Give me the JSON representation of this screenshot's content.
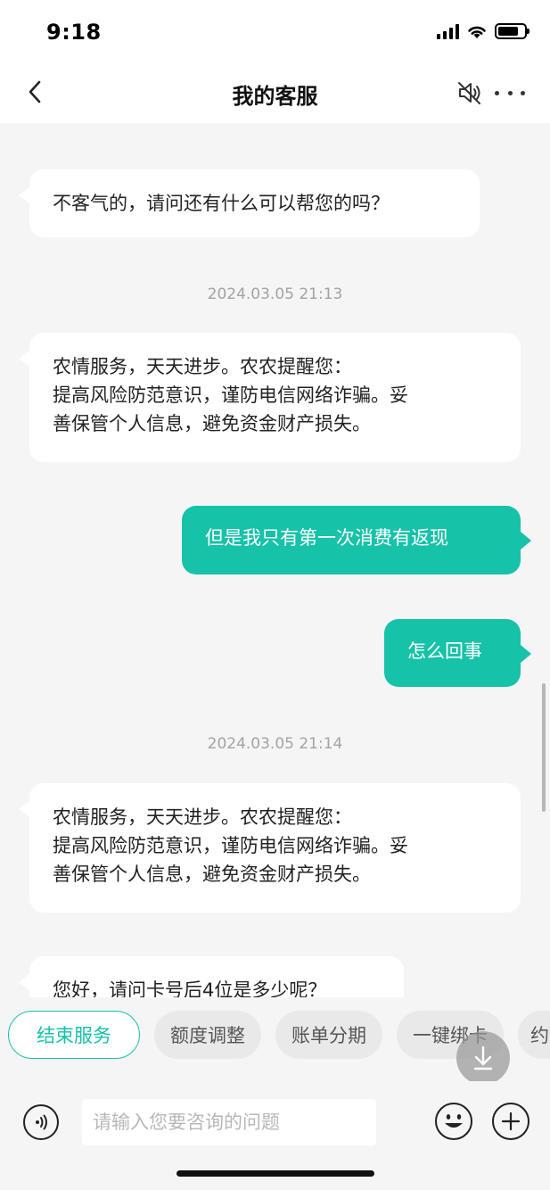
{
  "status_bar": {
    "time": "9:18"
  },
  "nav": {
    "title": "我的客服"
  },
  "messages": [
    {
      "side": "in",
      "lines": [
        "不客气的，请问还有什么可以帮您的吗？"
      ]
    },
    {
      "type": "timestamp",
      "text": "2024.03.05 21:13"
    },
    {
      "side": "in",
      "lines": [
        "农情服务，天天进步。农农提醒您：",
        "提高风险防范意识，谨防电信网络诈骗。妥",
        "善保管个人信息，避免资金财产损失。"
      ]
    },
    {
      "side": "out",
      "lines": [
        "但是我只有第一次消费有返现"
      ]
    },
    {
      "side": "out",
      "lines": [
        "怎么回事"
      ]
    },
    {
      "type": "timestamp",
      "text": "2024.03.05 21:14"
    },
    {
      "side": "in",
      "lines": [
        "农情服务，天天进步。农农提醒您：",
        "提高风险防范意识，谨防电信网络诈骗。妥",
        "善保管个人信息，避免资金财产损失。"
      ]
    },
    {
      "side": "in",
      "lines": [
        "您好，请问卡号后4位是多少呢？"
      ]
    }
  ],
  "quick_replies": [
    "结束服务",
    "额度调整",
    "账单分期",
    "一键绑卡",
    "约"
  ],
  "input": {
    "placeholder": "请输入您要咨询的问题"
  },
  "colors": {
    "accent": "#16c2a8",
    "background": "#f5f5f5",
    "bubble_in": "#ffffff"
  }
}
